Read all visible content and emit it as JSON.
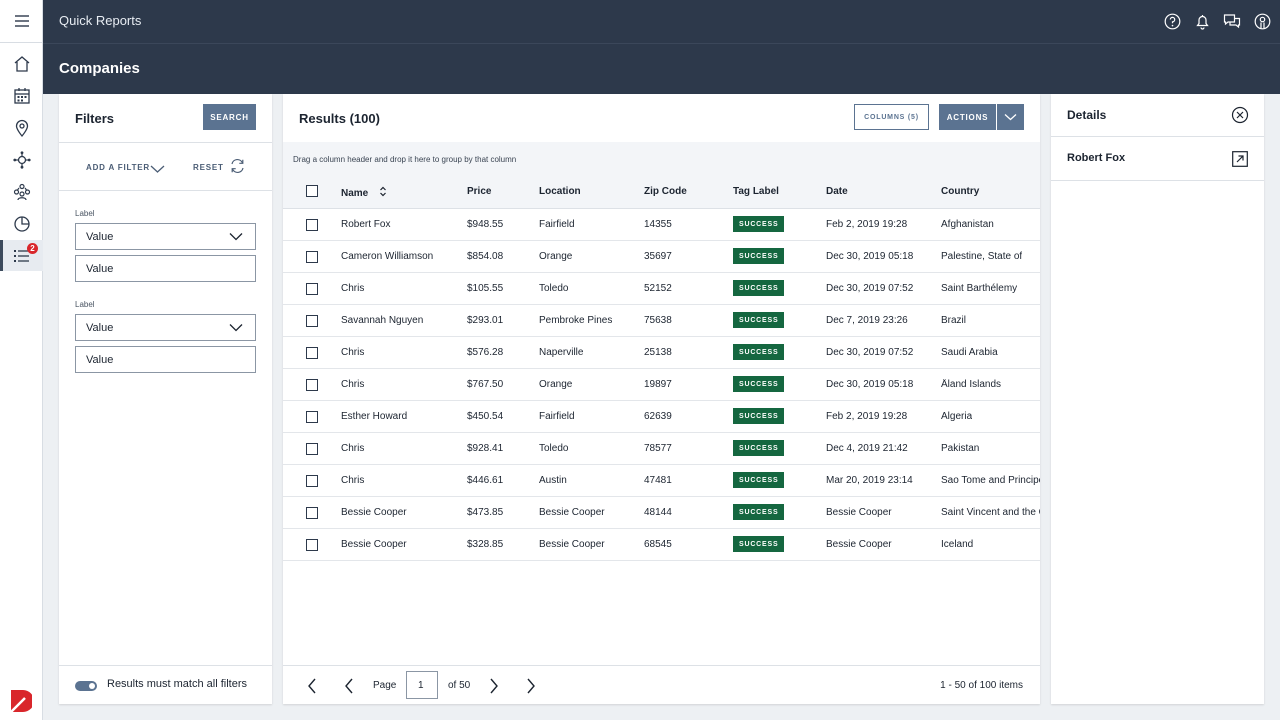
{
  "app": {
    "title": "Quick Reports"
  },
  "page": {
    "title": "Companies"
  },
  "nav": {
    "badge_count": "2"
  },
  "filters": {
    "title": "Filters",
    "search_label": "SEARCH",
    "add_filter_label": "ADD A FILTER",
    "reset_label": "RESET",
    "groups": [
      {
        "label": "Label",
        "select_value": "Value",
        "input_value": "Value"
      },
      {
        "label": "Label",
        "select_value": "Value",
        "input_value": "Value"
      }
    ],
    "toggle_label": "Results must match all filters",
    "toggle_on": true
  },
  "results": {
    "title": "Results (100)",
    "columns_button": "COLUMNS (5)",
    "actions_button": "ACTIONS",
    "group_hint": "Drag a column header and drop it here to group by that column",
    "columns": [
      "Name",
      "Price",
      "Location",
      "Zip Code",
      "Tag Label",
      "Date",
      "Country"
    ],
    "rows": [
      [
        "Robert Fox",
        "$948.55",
        "Fairfield",
        "14355",
        "SUCCESS",
        "Feb 2, 2019 19:28",
        "Afghanistan"
      ],
      [
        "Cameron Williamson",
        "$854.08",
        "Orange",
        "35697",
        "SUCCESS",
        "Dec 30, 2019 05:18",
        "Palestine, State of"
      ],
      [
        "Chris",
        "$105.55",
        "Toledo",
        "52152",
        "SUCCESS",
        "Dec 30, 2019 07:52",
        "Saint Barthélemy"
      ],
      [
        "Savannah Nguyen",
        "$293.01",
        "Pembroke Pines",
        "75638",
        "SUCCESS",
        "Dec 7, 2019 23:26",
        "Brazil"
      ],
      [
        "Chris",
        "$576.28",
        "Naperville",
        "25138",
        "SUCCESS",
        "Dec 30, 2019 07:52",
        "Saudi Arabia"
      ],
      [
        "Chris",
        "$767.50",
        "Orange",
        "19897",
        "SUCCESS",
        "Dec 30, 2019 05:18",
        "Åland Islands"
      ],
      [
        "Esther Howard",
        "$450.54",
        "Fairfield",
        "62639",
        "SUCCESS",
        "Feb 2, 2019 19:28",
        "Algeria"
      ],
      [
        "Chris",
        "$928.41",
        "Toledo",
        "78577",
        "SUCCESS",
        "Dec 4, 2019 21:42",
        "Pakistan"
      ],
      [
        "Chris",
        "$446.61",
        "Austin",
        "47481",
        "SUCCESS",
        "Mar 20, 2019 23:14",
        "Sao Tome and Principe"
      ],
      [
        "Bessie Cooper",
        "$473.85",
        "Bessie Cooper",
        "48144",
        "SUCCESS",
        "Bessie Cooper",
        "Saint Vincent and the Grenadines"
      ],
      [
        "Bessie Cooper",
        "$328.85",
        "Bessie Cooper",
        "68545",
        "SUCCESS",
        "Bessie Cooper",
        "Iceland"
      ]
    ],
    "pagination": {
      "page_label": "Page",
      "page_value": "1",
      "of_label": "of 50",
      "summary": "1 - 50 of 100 items"
    }
  },
  "details": {
    "title": "Details",
    "item_name": "Robert Fox"
  },
  "colors": {
    "header_bg": "#2d394b",
    "accent": "#5b7391",
    "success_tag": "#156740",
    "badge": "#d9262b"
  }
}
